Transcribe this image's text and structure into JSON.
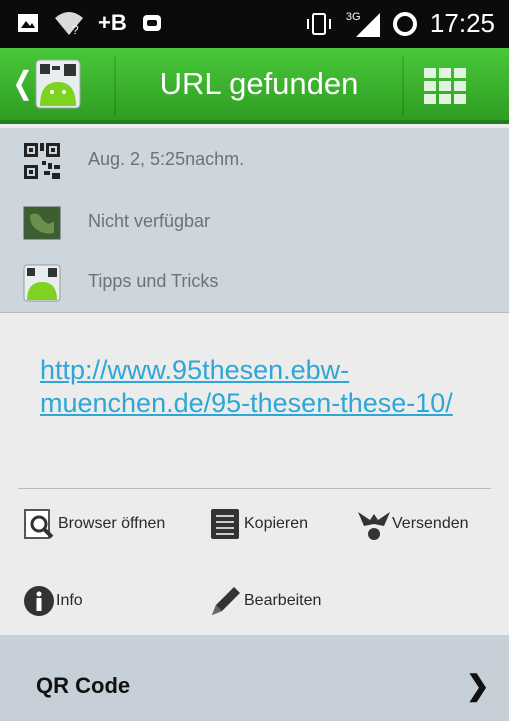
{
  "status_bar": {
    "plus_b": "+B",
    "network": "3G",
    "time": "17:25"
  },
  "action_bar": {
    "title": "URL gefunden"
  },
  "info": {
    "timestamp": "Aug. 2, 5:25nachm.",
    "location": "Nicht verfügbar",
    "tips": "Tipps und Tricks"
  },
  "url": "http://www.95thesen.ebw-muenchen.de/95-thesen-these-10/",
  "actions": {
    "browser": "Browser öffnen",
    "copy": "Kopieren",
    "send": "Versenden",
    "info": "Info",
    "edit": "Bearbeiten"
  },
  "qr_row": {
    "label": "QR Code"
  }
}
